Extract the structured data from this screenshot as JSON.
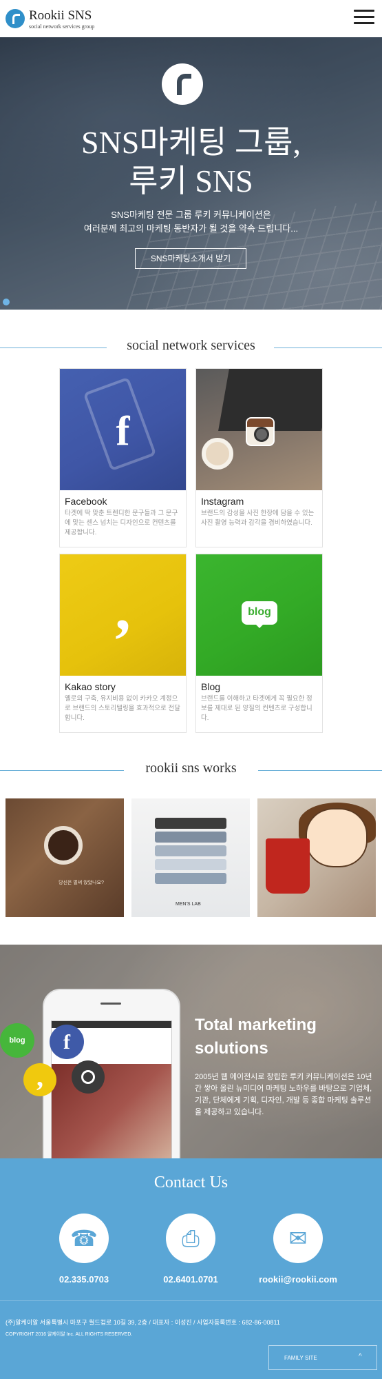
{
  "header": {
    "brand": "Rookii SNS",
    "tagline": "social network services group",
    "menu_icon": "hamburger-menu-icon"
  },
  "hero": {
    "title_line1": "SNS마케팅 그룹,",
    "title_line2": "루키 SNS",
    "desc_line1": "SNS마케팅 전문 그룹 루키 커뮤니케이션은",
    "desc_line2": "여러분께 최고의 마케팅 동반자가 될 것을 약속 드립니다...",
    "button_label": "SNS마케팅소개서 받기"
  },
  "sns_section": {
    "title": "social network services",
    "cards": [
      {
        "name": "Facebook",
        "text": "타겟에 딱 맞춘 트렌디한 문구들과 그 문구에 맞는 센스 넘치는 디자인으로 컨텐츠를 제공합니다."
      },
      {
        "name": "Instagram",
        "text": "브랜드의 감성을 사진 한장에 담을 수 있는 사진 촬영 능력과 감각을 겸비하였습니다."
      },
      {
        "name": "Kakao story",
        "text": "옐로의 구축, 유지비용 없이 카카오 계정으로 브랜드의 스토리텔링을 효과적으로 전달합니다."
      },
      {
        "name": "Blog",
        "text": "브랜드를 이해하고 타겟에게 꼭 필요한 정보를 제대로 된 양질의 컨텐츠로 구성합니다."
      }
    ],
    "icons": {
      "facebook": "f",
      "kakao": ",",
      "blog": "blog"
    }
  },
  "works_section": {
    "title": "rookii sns works",
    "work1_text": "당신은 벌써 앉았나요?",
    "work2_label": "MEN'S LAB"
  },
  "marketing": {
    "title_line1": "Total marketing",
    "title_line2": "solutions",
    "desc": "2005년 웹 에이전시로 창립한 루키 커뮤니케이션은 10년간 쌓아 올린 뉴미디어 마케팅 노하우를 바탕으로 기업체, 기관, 단체에게 기획, 디자인, 개발 등 종합 마케팅 솔루션을 제공하고 있습니다.",
    "blog_label": "blog",
    "fb_label": "f",
    "kakao_label": ","
  },
  "contact": {
    "title": "Contact Us",
    "items": [
      {
        "icon": "phone-icon",
        "glyph": "☎",
        "value": "02.335.0703"
      },
      {
        "icon": "fax-icon",
        "glyph": "⎙",
        "value": "02.6401.0701"
      },
      {
        "icon": "mail-icon",
        "glyph": "✉",
        "value": "rookii@rookii.com"
      }
    ]
  },
  "footer": {
    "address": "(주)알케이알 서울특별시 마포구 월드컵로 10길 39, 2층 / 대표자 : 이성진 / 사업자등록번호 : 682-86-00811",
    "copyright": "COPYRIGHT 2016 알케이알 Inc. ALL RIGHTS RESERVED.",
    "family_site": "FAMILY SITE",
    "family_caret": "^"
  },
  "colors": {
    "accent": "#5aa6d6",
    "facebook": "#3f5aa8",
    "kakao": "#eecb15",
    "blog": "#3bb52f"
  }
}
